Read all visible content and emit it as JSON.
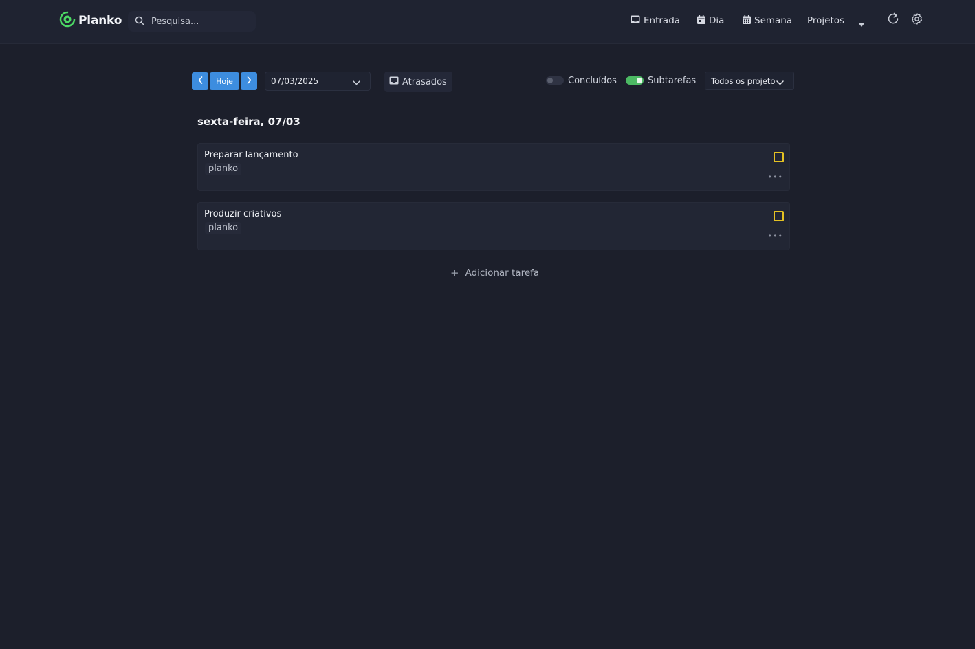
{
  "app": {
    "name": "Planko",
    "accent": "#4cd964"
  },
  "search": {
    "placeholder": "Pesquisa..."
  },
  "nav": {
    "entrada": "Entrada",
    "dia": "Dia",
    "semana": "Semana",
    "projetos": "Projetos"
  },
  "toolbar": {
    "today_label": "Hoje",
    "date_value": "07/03/2025",
    "overdue_label": "Atrasados",
    "completed_label": "Concluídos",
    "completed_on": false,
    "subtasks_label": "Subtarefas",
    "subtasks_on": true,
    "project_filter": "Todos os projetos"
  },
  "day": {
    "title": "sexta-feira, 07/03",
    "tasks": [
      {
        "title": "Preparar lançamento",
        "project": "planko"
      },
      {
        "title": "Produzir criativos",
        "project": "planko"
      }
    ],
    "add_task_label": "Adicionar tarefa"
  },
  "colors": {
    "background": "#1c1f2b",
    "primary_button": "#3d8ddf",
    "toggle_on": "#4cb963",
    "checkbox_border": "#e5c223"
  }
}
